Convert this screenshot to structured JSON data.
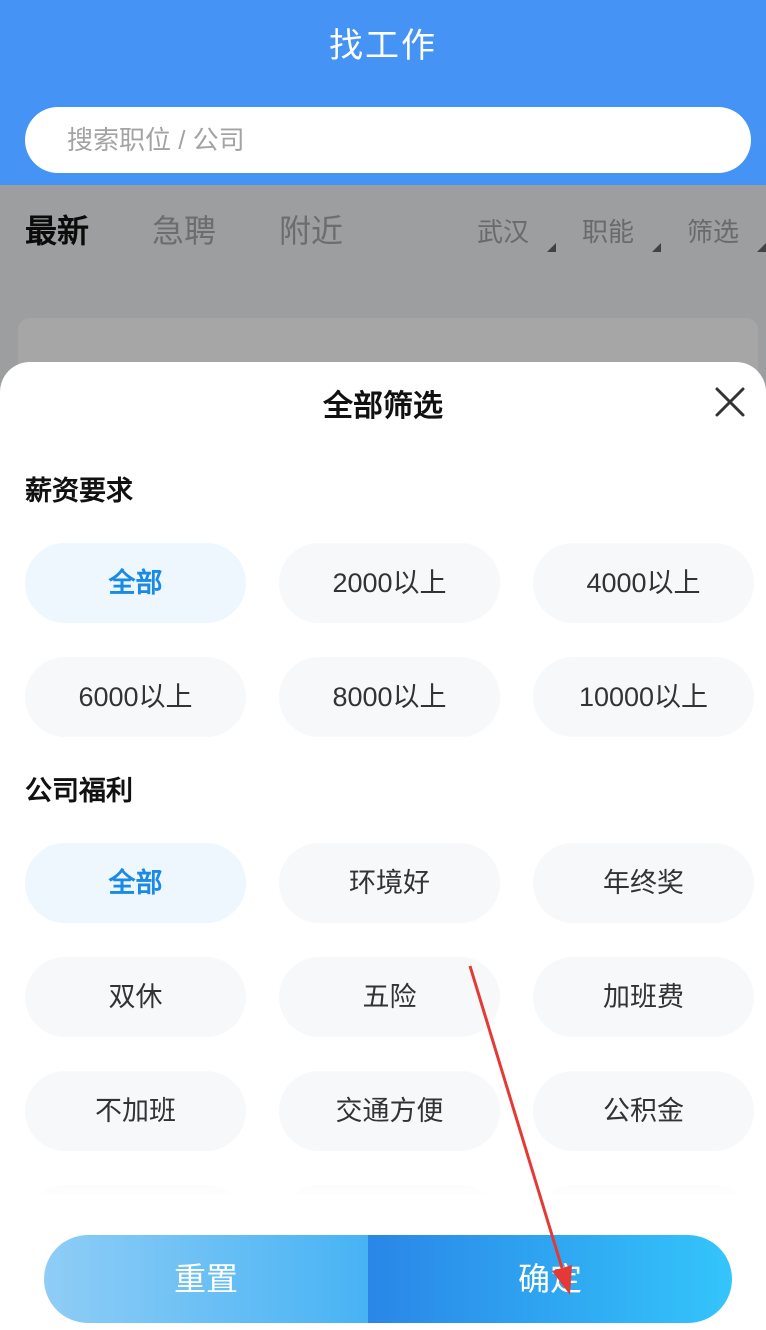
{
  "header": {
    "title": "找工作",
    "search_placeholder": "搜索职位 / 公司"
  },
  "tabs": [
    {
      "label": "最新",
      "active": true
    },
    {
      "label": "急聘",
      "active": false
    },
    {
      "label": "附近",
      "active": false
    }
  ],
  "filters": [
    {
      "label": "武汉"
    },
    {
      "label": "职能"
    },
    {
      "label": "筛选"
    }
  ],
  "sheet": {
    "title": "全部筛选",
    "close_icon": "close-icon",
    "sections": [
      {
        "label": "薪资要求",
        "options": [
          "全部",
          "2000以上",
          "4000以上",
          "6000以上",
          "8000以上",
          "10000以上"
        ],
        "selected": 0
      },
      {
        "label": "公司福利",
        "options": [
          "全部",
          "环境好",
          "年终奖",
          "双休",
          "五险",
          "加班费",
          "不加班",
          "交通方便",
          "公积金"
        ],
        "selected": 0
      }
    ],
    "reset_label": "重置",
    "confirm_label": "确定"
  },
  "colors": {
    "header_blue": "#4594f5",
    "selected_text": "#1a8ae6",
    "selected_bg": "#eef6fe",
    "chip_bg": "#f7f8fa",
    "annotation_arrow": "#e53935"
  }
}
